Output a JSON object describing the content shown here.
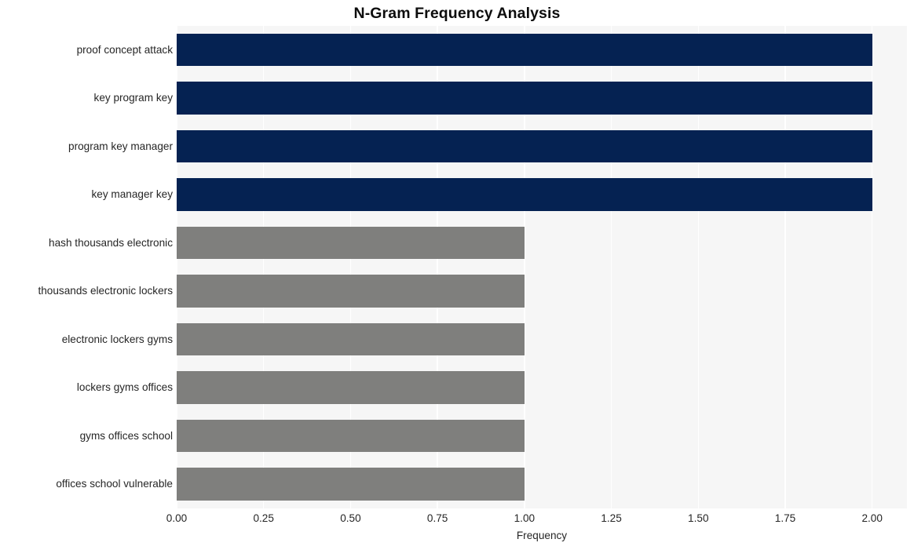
{
  "chart_data": {
    "type": "bar",
    "orientation": "horizontal",
    "title": "N-Gram Frequency Analysis",
    "xlabel": "Frequency",
    "ylabel": "",
    "categories": [
      "proof concept attack",
      "key program key",
      "program key manager",
      "key manager key",
      "hash thousands electronic",
      "thousands electronic lockers",
      "electronic lockers gyms",
      "lockers gyms offices",
      "gyms offices school",
      "offices school vulnerable"
    ],
    "values": [
      2,
      2,
      2,
      2,
      1,
      1,
      1,
      1,
      1,
      1
    ],
    "bar_colors": [
      "#052252",
      "#052252",
      "#052252",
      "#052252",
      "#7f7f7d",
      "#7f7f7d",
      "#7f7f7d",
      "#7f7f7d",
      "#7f7f7d",
      "#7f7f7d"
    ],
    "xlim": [
      0,
      2.1
    ],
    "xticks": [
      0,
      0.25,
      0.5,
      0.75,
      1,
      1.25,
      1.5,
      1.75,
      2
    ],
    "xtick_labels": [
      "0.00",
      "0.25",
      "0.50",
      "0.75",
      "1.00",
      "1.25",
      "1.50",
      "1.75",
      "2.00"
    ],
    "grid": true,
    "grid_axis": "x",
    "legend": false,
    "plot_background": "#f6f6f6",
    "figure_background": "#ffffff",
    "grid_color": "#ffffff",
    "title_color": "#0d0d0d",
    "tick_label_color": "#262626"
  }
}
